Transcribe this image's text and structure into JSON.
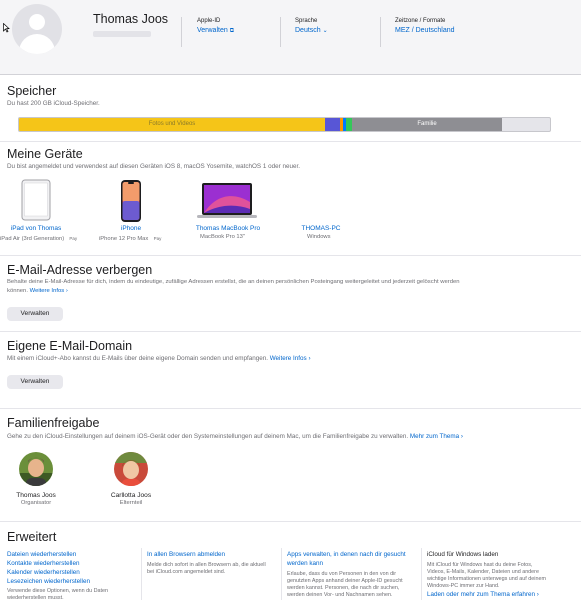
{
  "header": {
    "name": "Thomas Joos",
    "apple_id_label": "Apple-ID",
    "apple_id_action": "Verwalten",
    "language_label": "Sprache",
    "language_value": "Deutsch",
    "timezone_label": "Zeitzone / Formate",
    "timezone_value": "MEZ / Deutschland"
  },
  "storage": {
    "title": "Speicher",
    "subtitle": "Du hast 200 GB iCloud-Speicher.",
    "segments": [
      {
        "label": "Fotos und Videos",
        "color": "#f5c518"
      },
      {
        "label": "",
        "color": "#5856d6"
      },
      {
        "label": "",
        "color": "#ff9500"
      },
      {
        "label": "",
        "color": "#34c759"
      },
      {
        "label": "Familie",
        "color": "#8e8e93"
      }
    ]
  },
  "devices": {
    "title": "Meine Geräte",
    "subtitle": "Du bist angemeldet und verwendest auf diesen Geräten iOS 8, macOS Yosemite, watchOS 1 oder neuer.",
    "items": [
      {
        "name": "iPad von Thomas",
        "model": "iPad Air (3rd Generation)",
        "pay": "Pay"
      },
      {
        "name": "iPhone",
        "model": "iPhone 12 Pro Max",
        "pay": "Pay"
      },
      {
        "name": "Thomas MacBook Pro",
        "model": "MacBook Pro 13\""
      },
      {
        "name": "THOMAS-PC",
        "model": "Windows"
      }
    ]
  },
  "hide_email": {
    "title": "E-Mail-Adresse verbergen",
    "text": "Behalte deine E-Mail-Adresse für dich, indem du eindeutige, zufällige Adressen erstellst, die an deinen persönlichen Posteingang weitergeleitet und jederzeit gelöscht werden",
    "text2": "können.",
    "more": "Weitere Infos ›",
    "button": "Verwalten"
  },
  "custom_domain": {
    "title": "Eigene E-Mail-Domain",
    "text": "Mit einem iCloud+-Abo kannst du E-Mails über deine eigene Domain senden und empfangen.",
    "more": "Weitere Infos ›",
    "button": "Verwalten"
  },
  "family": {
    "title": "Familienfreigabe",
    "text": "Gehe zu den iCloud-Einstellungen auf deinem iOS-Gerät oder den Systemeinstellungen auf deinem Mac, um die Familienfreigabe zu verwalten.",
    "more": "Mehr zum Thema ›",
    "members": [
      {
        "name": "Thomas Joos",
        "role": "Organisator"
      },
      {
        "name": "Carllotta Joos",
        "role": "Elternteil"
      }
    ]
  },
  "advanced": {
    "title": "Erweitert",
    "restore_links": [
      "Dateien wiederherstellen",
      "Kontakte wiederherstellen",
      "Kalender wiederherstellen",
      "Lesezeichen wiederherstellen"
    ],
    "restore_note": [
      "Verwende diese Optionen, wenn du Daten",
      "wiederherstellen musst."
    ],
    "signout_link": "In allen Browsern abmelden",
    "signout_text": [
      "Melde dich sofort in allen Browsern ab, die aktuell",
      "bei iCloud.com angemeldet sind."
    ],
    "apps_link": [
      "Apps verwalten, in denen nach dir gesucht",
      "werden kann"
    ],
    "apps_text": [
      "Erlaube, dass du von Personen in den von dir",
      "genutzten Apps anhand deiner Apple-ID gesucht",
      "werden kannst. Personen, die nach dir suchen,",
      "werden deinen Vor- und Nachnamen sehen."
    ],
    "windows_title": "iCloud für Windows laden",
    "windows_text": [
      "Mit iCloud für Windows hast du deine Fotos,",
      "Videos, E-Mails, Kalender, Dateien und andere",
      "wichtige Informationen unterwegs und auf deinem",
      "Windows-PC immer zur Hand."
    ],
    "windows_link": "Laden oder mehr zum Thema erfahren ›"
  }
}
